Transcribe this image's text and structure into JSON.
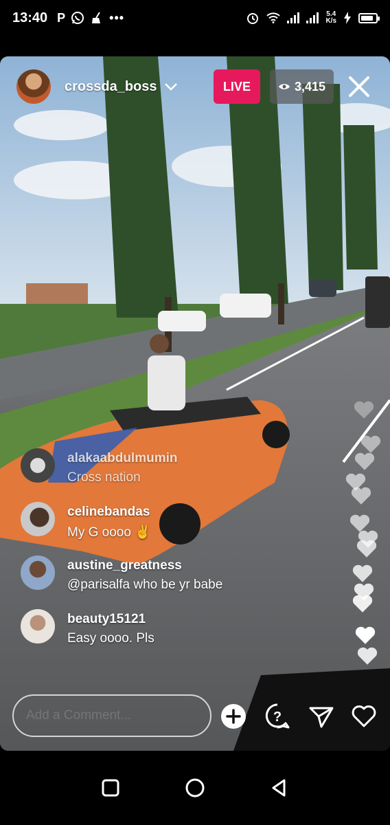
{
  "status_bar": {
    "time": "13:40",
    "left_icons": [
      "P",
      "whatsapp-icon",
      "broom-icon",
      "•••"
    ],
    "net_speed_value": "5.4",
    "net_speed_unit": "K/s",
    "battery_level": 0.85
  },
  "live": {
    "host_username": "crossda_boss",
    "live_label": "LIVE",
    "viewer_count": "3,415",
    "colors": {
      "live_badge": "#e6195c",
      "viewer_badge": "#5a5a5a"
    }
  },
  "comments": [
    {
      "username": "alakaabdulmumin",
      "text": "Cross nation"
    },
    {
      "username": "celinebandas",
      "text": "My G oooo ✌️"
    },
    {
      "username": "austine_greatness",
      "text": "@parisalfa who be yr babe"
    },
    {
      "username": "beauty15121",
      "text": "Easy oooo. Pls"
    }
  ],
  "comment_input": {
    "placeholder": "Add a Comment..."
  },
  "actions": [
    "add-icon",
    "question-icon",
    "send-icon",
    "heart-icon"
  ],
  "nav": [
    "recents-button",
    "home-button",
    "back-button"
  ]
}
